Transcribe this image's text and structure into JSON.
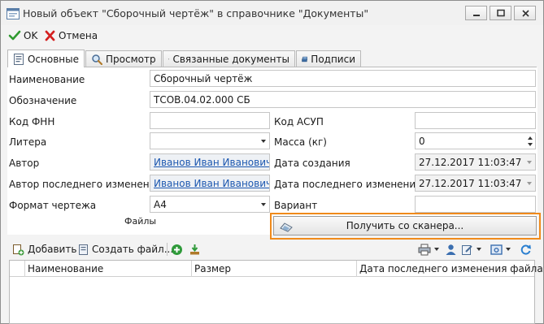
{
  "window": {
    "title": "Новый объект \"Сборочный чертёж\" в справочнике \"Документы\""
  },
  "toolbar": {
    "ok_label": "OK",
    "cancel_label": "Отмена"
  },
  "tabs": [
    {
      "label": "Основные",
      "icon": "document-list-icon",
      "active": true
    },
    {
      "label": "Просмотр",
      "icon": "magnifier-icon",
      "active": false
    },
    {
      "label": "Связанные документы",
      "icon": "linked-documents-icon",
      "active": false
    },
    {
      "label": "Подписи",
      "icon": "signatures-stack-icon",
      "active": false
    }
  ],
  "form": {
    "name": {
      "label": "Наименование",
      "value": "Сборочный чертёж"
    },
    "designation": {
      "label": "Обозначение",
      "value": "ТСОВ.04.02.000 СБ"
    },
    "fnn_code": {
      "label": "Код ФНН",
      "value": ""
    },
    "asup_code": {
      "label": "Код АСУП",
      "value": ""
    },
    "litera": {
      "label": "Литера",
      "value": ""
    },
    "mass": {
      "label": "Масса (кг)",
      "value": "0"
    },
    "author": {
      "label": "Автор",
      "value": "Иванов Иван Иванович"
    },
    "created": {
      "label": "Дата создания",
      "value": "27.12.2017 11:03:47"
    },
    "last_modifier": {
      "label": "Автор последнего изменения",
      "value": "Иванов Иван Иванович"
    },
    "modified": {
      "label": "Дата последнего изменения",
      "value": "27.12.2017 11:03:47"
    },
    "drawing_format": {
      "label": "Формат чертежа",
      "value": "А4"
    },
    "variant": {
      "label": "Вариант",
      "value": ""
    },
    "files_label": "Файлы",
    "scan_button": "Получить со сканера..."
  },
  "files_toolbar": {
    "add_label": "Добавить",
    "create_file_label": "Создать файл..."
  },
  "files_table": {
    "columns": [
      "Наименование",
      "Размер",
      "Дата последнего изменения файла"
    ],
    "rows": []
  },
  "colors": {
    "highlight": "#f08a1a",
    "link": "#1d58b0",
    "ok_check": "#2f9a2f",
    "cancel_x": "#d42020"
  }
}
